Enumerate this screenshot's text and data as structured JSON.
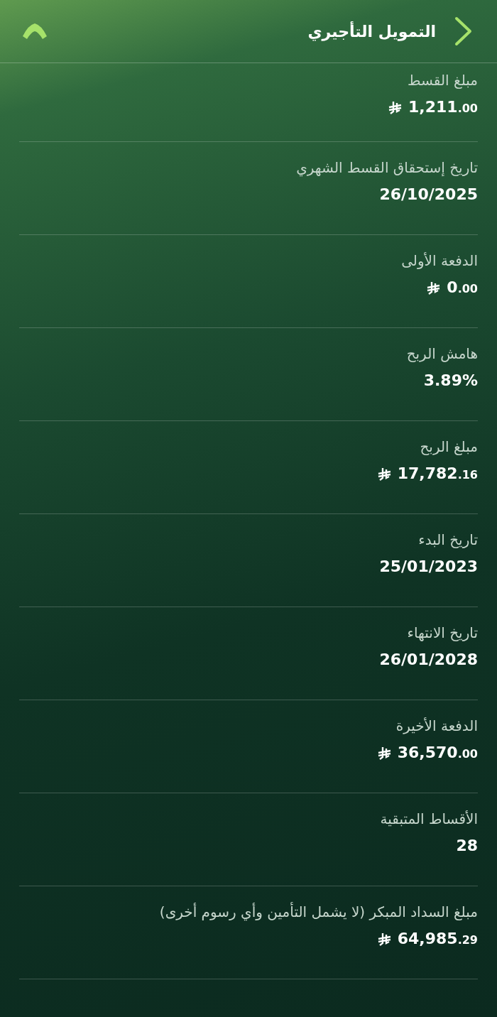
{
  "header": {
    "title": "التمويل التأجيري"
  },
  "rows": [
    {
      "label": "مبلغ القسط",
      "value": "1,211.00",
      "kind": "currency"
    },
    {
      "label": "تاريخ إستحقاق القسط الشهري",
      "value": "26/10/2025",
      "kind": "text"
    },
    {
      "label": "الدفعة الأولى",
      "value": "0.00",
      "kind": "currency"
    },
    {
      "label": "هامش الربح",
      "value": "3.89%",
      "kind": "text"
    },
    {
      "label": "مبلغ الربح",
      "value": "17,782.16",
      "kind": "currency"
    },
    {
      "label": "تاريخ البدء",
      "value": "25/01/2023",
      "kind": "text"
    },
    {
      "label": "تاريخ الانتهاء",
      "value": "26/01/2028",
      "kind": "text"
    },
    {
      "label": "الدفعة الأخيرة",
      "value": "36,570.00",
      "kind": "currency"
    },
    {
      "label": "الأقساط المتبقية",
      "value": "28",
      "kind": "text"
    },
    {
      "label": "مبلغ السداد المبكر (لا يشمل التأمين وأي رسوم أخرى)",
      "value": "64,985.29",
      "kind": "currency"
    }
  ]
}
